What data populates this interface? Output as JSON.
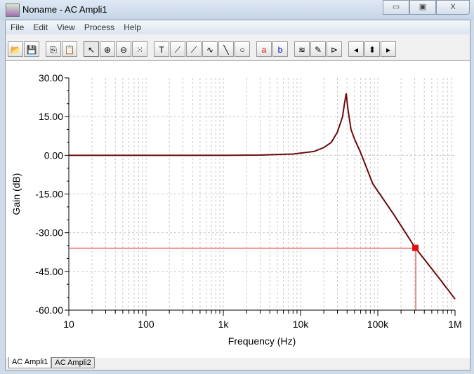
{
  "window": {
    "title": "Noname - AC Ampli1",
    "min": "▭",
    "max": "▣",
    "close": "X"
  },
  "menu": [
    "File",
    "Edit",
    "View",
    "Process",
    "Help"
  ],
  "toolbar": [
    {
      "icon": "open-folder-icon",
      "g": "📂"
    },
    {
      "icon": "save-icon",
      "g": "💾"
    },
    {
      "icon": "copy-icon",
      "g": "⎘"
    },
    {
      "icon": "paste-icon",
      "g": "📋"
    },
    {
      "icon": "pointer-icon",
      "g": "↖"
    },
    {
      "icon": "zoom-in-icon",
      "g": "⊕"
    },
    {
      "icon": "zoom-100-icon",
      "g": "⊖"
    },
    {
      "icon": "grid-icon",
      "g": "⁙"
    },
    {
      "icon": "text-icon",
      "g": "T"
    },
    {
      "icon": "curve-label-icon",
      "g": "⟋"
    },
    {
      "icon": "curve-query-icon",
      "g": "⟋"
    },
    {
      "icon": "curve-formula-icon",
      "g": "∿"
    },
    {
      "icon": "line-icon",
      "g": "╲"
    },
    {
      "icon": "ellipse-icon",
      "g": "○"
    },
    {
      "icon": "cursor-a-icon",
      "g": "a"
    },
    {
      "icon": "cursor-b-icon",
      "g": "b"
    },
    {
      "icon": "add-curves-icon",
      "g": "≋"
    },
    {
      "icon": "pick-color-icon",
      "g": "✎"
    },
    {
      "icon": "marker-icon",
      "g": "⊳"
    },
    {
      "icon": "arrow-left-icon",
      "g": "◂"
    },
    {
      "icon": "arrow-updown-icon",
      "g": "⬍"
    },
    {
      "icon": "arrow-right-icon",
      "g": "▸"
    }
  ],
  "tabs": [
    "AC Ampli1",
    "AC Ampli2"
  ],
  "colors": {
    "curve": "#6b0a0a",
    "cursor": "#e01010",
    "grid": "#c8c8c8"
  },
  "chart_data": {
    "type": "line",
    "xlabel": "Frequency (Hz)",
    "ylabel": "Gain (dB)",
    "xscale": "log",
    "xlim": [
      10,
      1000000
    ],
    "ylim": [
      -60,
      30
    ],
    "xticks": [
      {
        "v": 10,
        "l": "10"
      },
      {
        "v": 100,
        "l": "100"
      },
      {
        "v": 1000,
        "l": "1k"
      },
      {
        "v": 10000,
        "l": "10k"
      },
      {
        "v": 100000,
        "l": "100k"
      },
      {
        "v": 1000000,
        "l": "1M"
      }
    ],
    "yticks": [
      {
        "v": 30,
        "l": "30.00"
      },
      {
        "v": 15,
        "l": "15.00"
      },
      {
        "v": 0,
        "l": "0.00"
      },
      {
        "v": -15,
        "l": "-15.00"
      },
      {
        "v": -30,
        "l": "-30.00"
      },
      {
        "v": -45,
        "l": "-45.00"
      },
      {
        "v": -60,
        "l": "-60.00"
      }
    ],
    "grid": true,
    "series": [
      {
        "name": "Gain",
        "x": [
          10,
          100,
          1000,
          3000,
          8000,
          15000,
          20000,
          25000,
          30000,
          35000,
          37000,
          39000,
          41000,
          45000,
          50000,
          60000,
          86000,
          160000,
          300000,
          600000,
          1000000
        ],
        "y": [
          0,
          0,
          0,
          0.1,
          0.5,
          1.5,
          3,
          5,
          9,
          15,
          20,
          24,
          18,
          10,
          6.3,
          1,
          -11,
          -22.8,
          -35.5,
          -47,
          -55.7
        ]
      }
    ],
    "cursor": {
      "x": 310000,
      "y": -36
    }
  }
}
